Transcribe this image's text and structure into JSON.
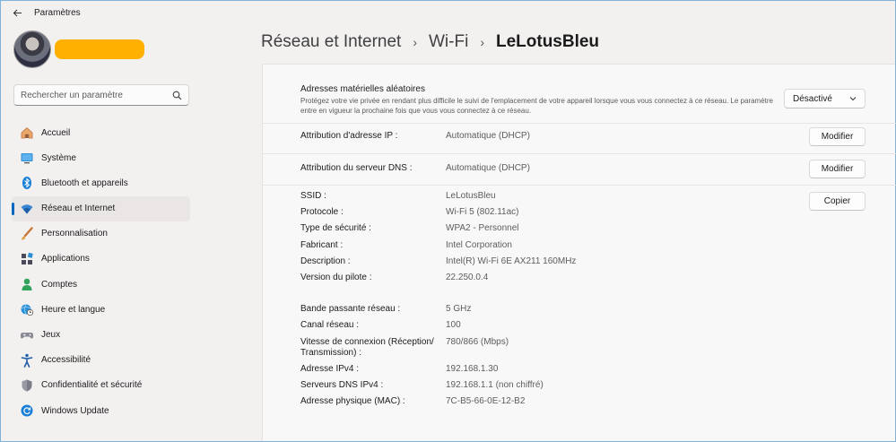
{
  "app": {
    "title": "Paramètres"
  },
  "search": {
    "placeholder": "Rechercher un paramètre"
  },
  "sidebar": {
    "items": [
      {
        "label": "Accueil",
        "icon": "home-icon"
      },
      {
        "label": "Système",
        "icon": "system-icon"
      },
      {
        "label": "Bluetooth et appareils",
        "icon": "bluetooth-icon"
      },
      {
        "label": "Réseau et Internet",
        "icon": "wifi-icon",
        "active": true
      },
      {
        "label": "Personnalisation",
        "icon": "brush-icon"
      },
      {
        "label": "Applications",
        "icon": "apps-icon"
      },
      {
        "label": "Comptes",
        "icon": "account-icon"
      },
      {
        "label": "Heure et langue",
        "icon": "globe-clock-icon"
      },
      {
        "label": "Jeux",
        "icon": "gamepad-icon"
      },
      {
        "label": "Accessibilité",
        "icon": "accessibility-icon"
      },
      {
        "label": "Confidentialité et sécurité",
        "icon": "shield-icon"
      },
      {
        "label": "Windows Update",
        "icon": "update-icon"
      }
    ]
  },
  "breadcrumb": {
    "items": [
      "Réseau et Internet",
      "Wi-Fi",
      "LeLotusBleu"
    ],
    "separator": "›"
  },
  "mac": {
    "title": "Adresses matérielles aléatoires",
    "description": "Protégez votre vie privée en rendant plus difficile le suivi de l'emplacement de votre appareil lorsque vous vous connectez à ce réseau. Le paramètre entre en vigueur la prochaine fois que vous vous connectez à ce réseau.",
    "value": "Désactivé"
  },
  "ip": {
    "label": "Attribution d'adresse IP :",
    "value": "Automatique (DHCP)",
    "button": "Modifier"
  },
  "dns": {
    "label": "Attribution du serveur DNS :",
    "value": "Automatique (DHCP)",
    "button": "Modifier"
  },
  "copy_button": "Copier",
  "properties": {
    "group1": [
      {
        "k": "SSID :",
        "v": "LeLotusBleu"
      },
      {
        "k": "Protocole :",
        "v": "Wi-Fi 5 (802.11ac)"
      },
      {
        "k": "Type de sécurité :",
        "v": "WPA2 - Personnel"
      },
      {
        "k": "Fabricant :",
        "v": "Intel Corporation"
      },
      {
        "k": "Description :",
        "v": "Intel(R) Wi-Fi 6E AX211 160MHz"
      },
      {
        "k": "Version du pilote :",
        "v": "22.250.0.4"
      }
    ],
    "group2": [
      {
        "k": "Bande passante réseau :",
        "v": "5 GHz"
      },
      {
        "k": "Canal réseau :",
        "v": "100"
      },
      {
        "k": "Vitesse de connexion (Réception/ Transmission) :",
        "v": "780/866 (Mbps)"
      },
      {
        "k": "Adresse IPv4 :",
        "v": "192.168.1.30"
      },
      {
        "k": "Serveurs DNS IPv4 :",
        "v": "192.168.1.1 (non chiffré)"
      },
      {
        "k": "Adresse physique (MAC) :",
        "v": "7C-B5-66-0E-12-B2"
      }
    ]
  },
  "colors": {
    "accent": "#0067c0",
    "redaction": "#ffb000"
  }
}
